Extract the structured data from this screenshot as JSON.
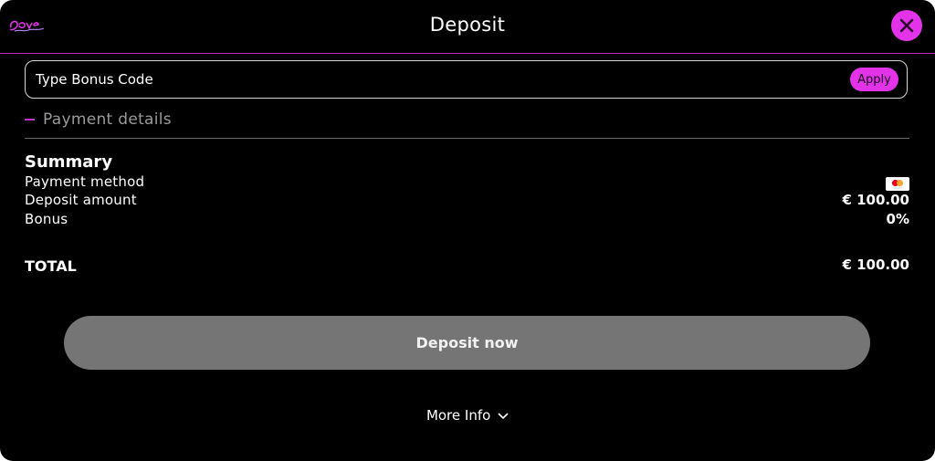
{
  "brand": {
    "logo_text": "Love Casino",
    "logo_icon": "brand-logo"
  },
  "header": {
    "title": "Deposit",
    "close_icon": "close-icon"
  },
  "bonus": {
    "placeholder": "Type Bonus Code",
    "value": "",
    "apply_label": "Apply"
  },
  "payment_details": {
    "label": "Payment details",
    "expanded": true
  },
  "summary": {
    "title": "Summary",
    "rows": [
      {
        "label": "Payment method",
        "value": "",
        "icon": "mastercard-icon"
      },
      {
        "label": "Deposit amount",
        "value": "€ 100.00"
      },
      {
        "label": "Bonus",
        "value": "0%"
      }
    ],
    "total_label": "TOTAL",
    "total_value": "€ 100.00"
  },
  "actions": {
    "deposit_label": "Deposit now",
    "more_info_label": "More Info"
  },
  "colors": {
    "accent": "#e233e8",
    "background": "#000000",
    "disabled_button": "#757575",
    "mastercard_red": "#eb001b",
    "mastercard_orange": "#f79e1b"
  }
}
